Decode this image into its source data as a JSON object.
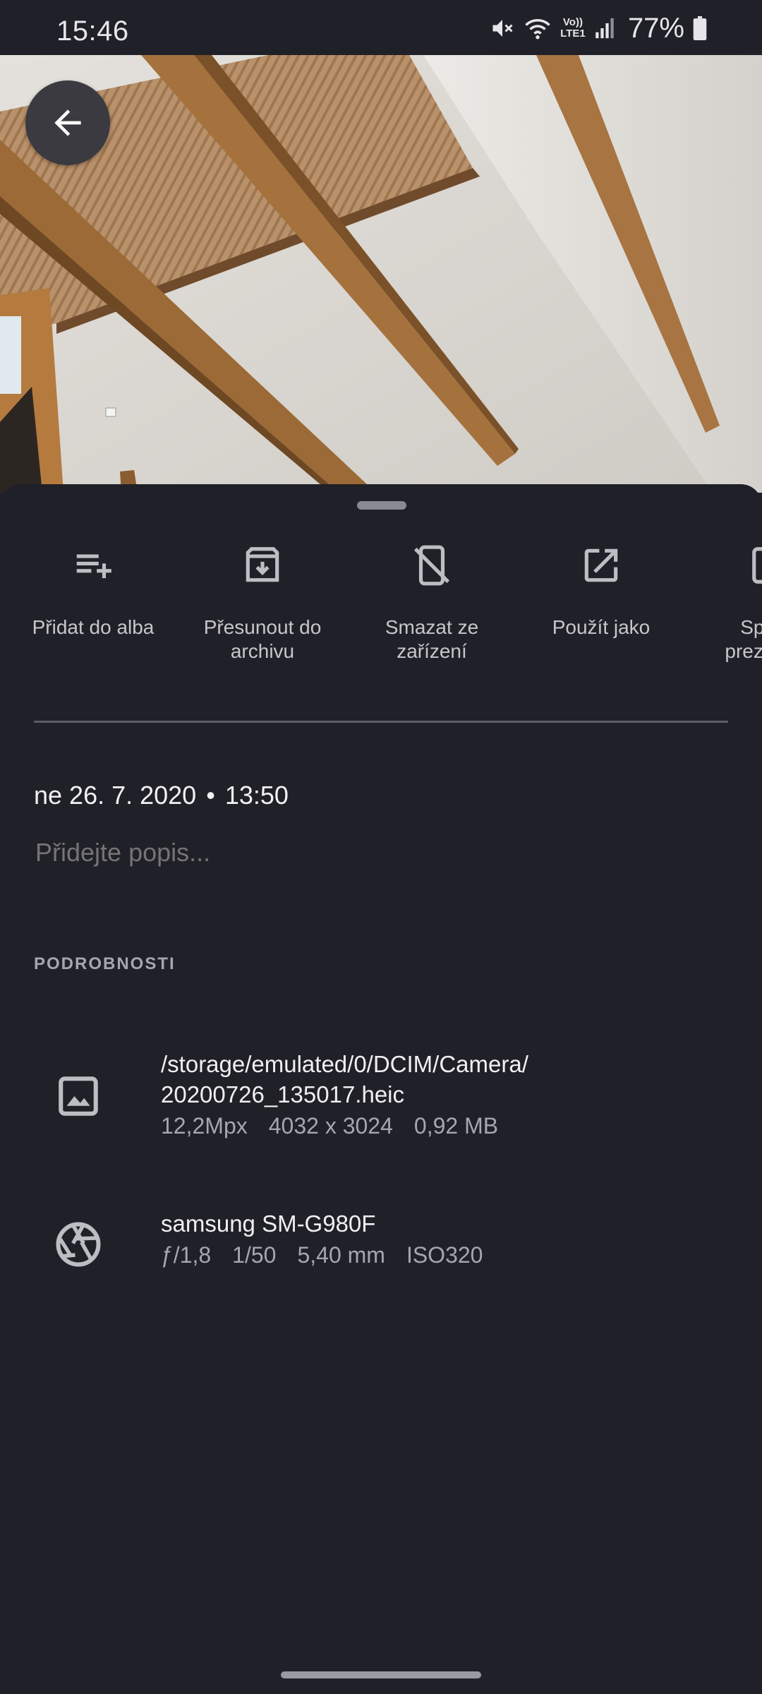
{
  "status_bar": {
    "time": "15:46",
    "battery": "77%",
    "icons": [
      "mute-icon",
      "wifi-icon",
      "volte-icon",
      "signal-icon",
      "battery-icon"
    ],
    "volte_label": "Vo)) LTE1"
  },
  "photo": {
    "back_icon": "arrow-left-icon"
  },
  "actions": [
    {
      "label": "Přidat do alba",
      "icon": "playlist-add-icon"
    },
    {
      "label": "Přesunout do archivu",
      "icon": "archive-icon"
    },
    {
      "label": "Smazat ze zařízení",
      "icon": "mobile-off-icon"
    },
    {
      "label": "Použít jako",
      "icon": "open-in-new-icon"
    },
    {
      "label": "Spustit prezentaci",
      "icon": "slideshow-icon"
    }
  ],
  "datetime": {
    "date": "ne 26. 7. 2020",
    "separator": "•",
    "time": "13:50"
  },
  "caption": {
    "placeholder": "Přidejte popis..."
  },
  "details": {
    "title": "PODROBNOSTI",
    "file": {
      "path_line1": "/storage/emulated/0/DCIM/Camera/",
      "path_line2": "20200726_135017.heic",
      "megapixels": "12,2Mpx",
      "resolution": "4032 x 3024",
      "size": "0,92 MB",
      "icon": "image-icon"
    },
    "camera": {
      "model": "samsung SM-G980F",
      "aperture": "ƒ/1,8",
      "shutter": "1/50",
      "focal_length": "5,40 mm",
      "iso": "ISO320",
      "icon": "camera-aperture-icon"
    }
  },
  "colors": {
    "background": "#202028",
    "text_primary": "#f0f0f2",
    "text_secondary": "#a6a6ae",
    "icon": "#bdbdc4"
  }
}
